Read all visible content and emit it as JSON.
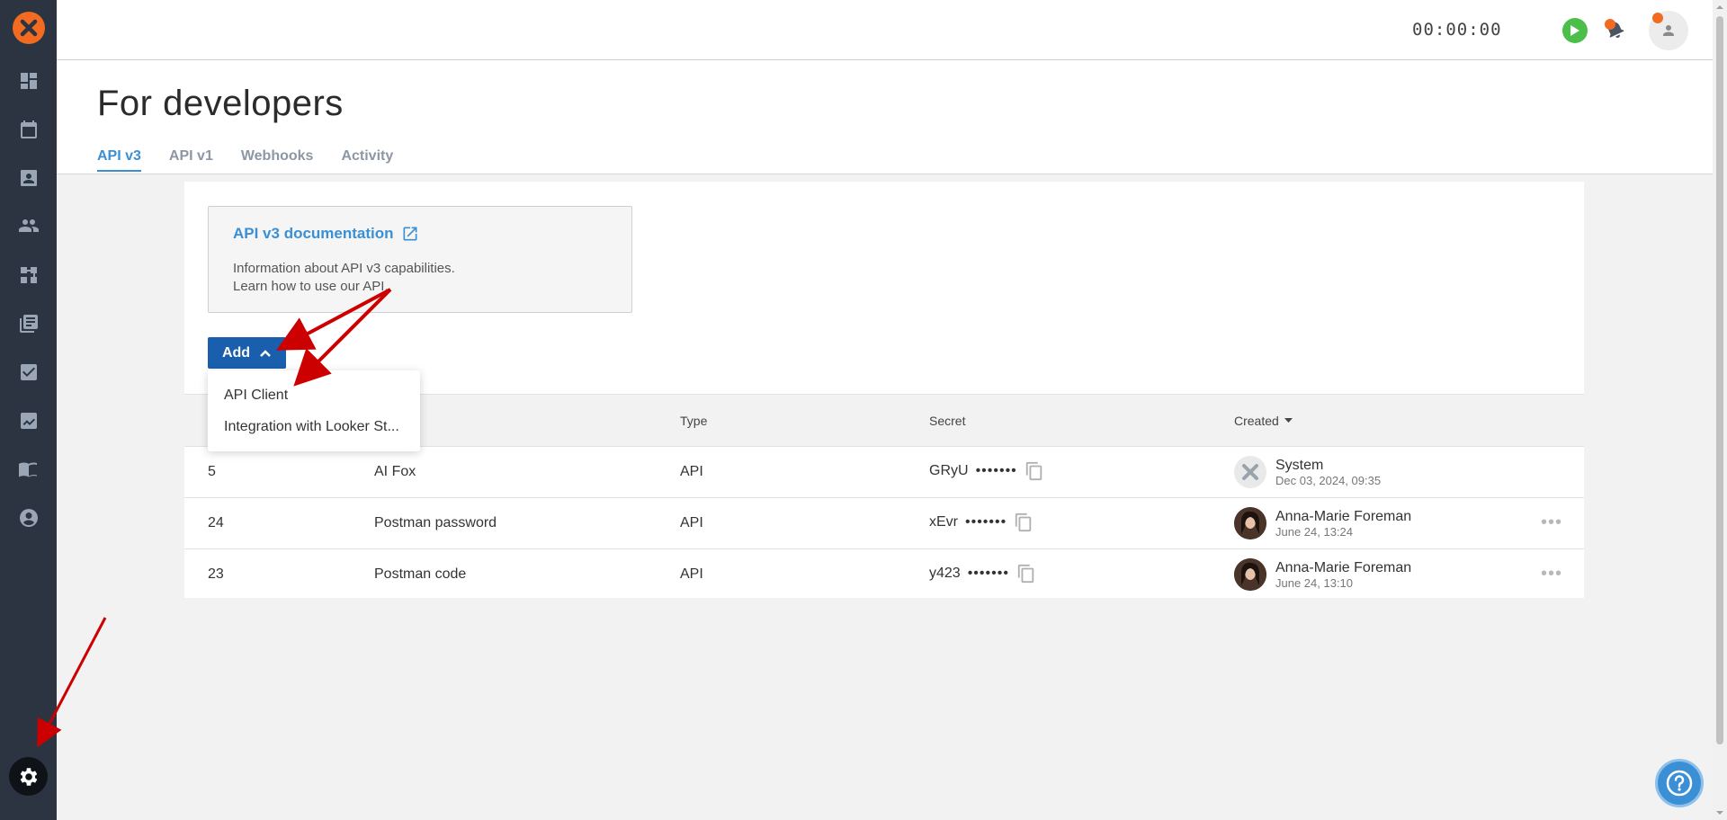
{
  "sidebar": {
    "items": [
      {
        "name": "dashboard-icon"
      },
      {
        "name": "calendar-icon"
      },
      {
        "name": "contacts-icon"
      },
      {
        "name": "users-icon"
      },
      {
        "name": "workflow-icon"
      },
      {
        "name": "library-icon"
      },
      {
        "name": "tasks-icon"
      },
      {
        "name": "reports-icon"
      },
      {
        "name": "knowledge-base-icon"
      },
      {
        "name": "profile-icon"
      }
    ],
    "settings_icon": "gear-icon"
  },
  "header": {
    "timer": "00:00:00"
  },
  "page": {
    "title": "For developers",
    "tabs": [
      {
        "label": "API v3",
        "active": true
      },
      {
        "label": "API v1",
        "active": false
      },
      {
        "label": "Webhooks",
        "active": false
      },
      {
        "label": "Activity",
        "active": false
      }
    ]
  },
  "doc_box": {
    "title": "API v3 documentation",
    "line1": "Information about API v3 capabilities.",
    "line2": "Learn how to use our API."
  },
  "add_button": {
    "label": "Add"
  },
  "dropdown": {
    "items": [
      "API Client",
      "Integration with Looker St..."
    ]
  },
  "table": {
    "columns": {
      "type": "Type",
      "secret": "Secret",
      "created": "Created"
    },
    "rows": [
      {
        "id": "5",
        "name": "AI Fox",
        "type": "API",
        "secret_prefix": "GRyU",
        "secret_mask": "•••••••",
        "created_by": "System",
        "created_at": "Dec 03, 2024, 09:35",
        "has_menu": false
      },
      {
        "id": "24",
        "name": "Postman password",
        "type": "API",
        "secret_prefix": "xEvr",
        "secret_mask": "•••••••",
        "created_by": "Anna-Marie Foreman",
        "created_at": "June 24, 13:24",
        "has_menu": true
      },
      {
        "id": "23",
        "name": "Postman code",
        "type": "API",
        "secret_prefix": "y423",
        "secret_mask": "•••••••",
        "created_by": "Anna-Marie Foreman",
        "created_at": "June 24, 13:10",
        "has_menu": true
      }
    ]
  },
  "colors": {
    "accent": "#3b8fd4",
    "primary_button": "#1a5fae",
    "brand": "#f26b21",
    "sidebar": "#2b3440",
    "annotation": "#cc0000"
  }
}
